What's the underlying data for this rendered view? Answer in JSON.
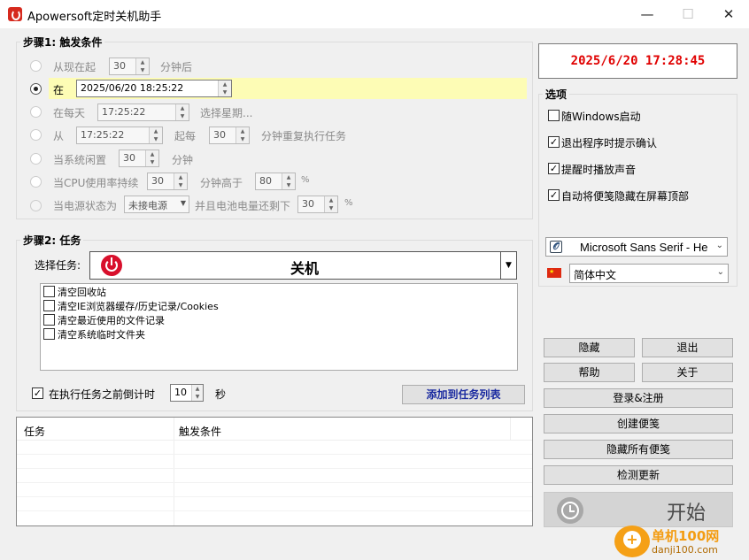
{
  "window": {
    "title": "Apowersoft定时关机助手",
    "minimize": "—",
    "maximize": "☐",
    "close": "✕"
  },
  "datetime": "2025/6/20  17:28:45",
  "step1": {
    "legend": "步骤1: 触发条件",
    "from_now": {
      "label": "从现在起",
      "value": "30",
      "suffix": "分钟后"
    },
    "at": {
      "label": "在",
      "value": "2025/06/20   18:25:22"
    },
    "daily": {
      "label": "在每天",
      "value": "17:25:22",
      "week_button": "选择星期..."
    },
    "from": {
      "label": "从",
      "value": "17:25:22",
      "every_label": "起每",
      "every_value": "30",
      "suffix": "分钟重复执行任务"
    },
    "idle": {
      "label": "当系统闲置",
      "value": "30",
      "suffix": "分钟"
    },
    "cpu": {
      "label": "当CPU使用率持续",
      "value": "30",
      "mid": "分钟高于",
      "percent_value": "80",
      "percent": "%"
    },
    "power": {
      "label": "当电源状态为",
      "select": "未接电源",
      "mid": "并且电池电量还剩下",
      "value": "30",
      "percent": "%"
    }
  },
  "options": {
    "legend": "选项",
    "items": [
      {
        "label": "随Windows启动",
        "checked": false
      },
      {
        "label": "退出程序时提示确认",
        "checked": true
      },
      {
        "label": "提醒时播放声音",
        "checked": true
      },
      {
        "label": "自动将便笺隐藏在屏幕顶部",
        "checked": true
      }
    ],
    "font": "Microsoft Sans Serif   - He",
    "language": "简体中文"
  },
  "step2": {
    "legend": "步骤2: 任务",
    "select_label": "选择任务:",
    "task": "关机",
    "subtasks": [
      "清空回收站",
      "清空IE浏览器缓存/历史记录/Cookies",
      "清空最近使用的文件记录",
      "清空系统临时文件夹"
    ],
    "countdown_label": "在执行任务之前倒计时",
    "countdown_value": "10",
    "countdown_unit": "秒",
    "add_button": "添加到任务列表"
  },
  "task_list": {
    "col_task": "任务",
    "col_trigger": "触发条件"
  },
  "buttons": {
    "hide": "隐藏",
    "exit": "退出",
    "help": "帮助",
    "about": "关于",
    "login": "登录&注册",
    "create_note": "创建便笺",
    "hide_notes": "隐藏所有便笺",
    "check_update": "检测更新",
    "start": "开始"
  },
  "watermark": {
    "text1": "单机100网",
    "text2": "danji100.com"
  },
  "colors": {
    "datetime": "#e00000",
    "highlight": "#fdfcb5",
    "power_icon": "#d8102c"
  }
}
